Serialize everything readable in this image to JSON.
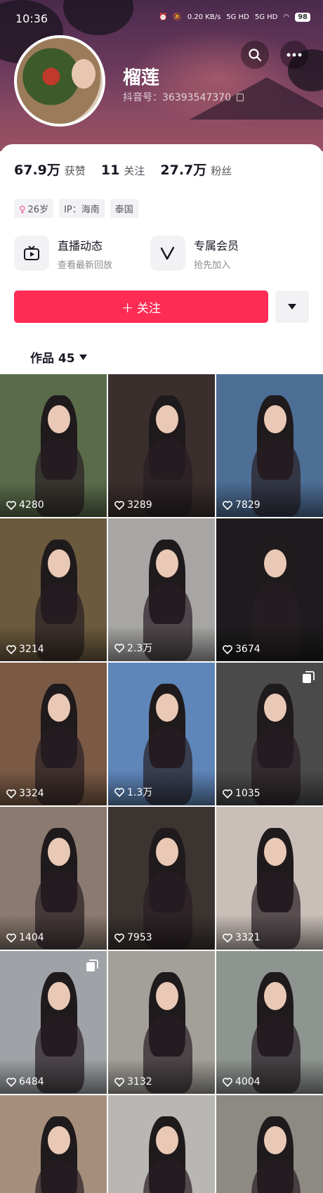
{
  "status_bar": {
    "time": "10:36",
    "net_speed": "0.20 KB/s",
    "signal_1": "5G HD",
    "signal_2": "5G HD",
    "battery": "98"
  },
  "profile": {
    "username": "榴莲",
    "douyin_id": "抖音号：36393547370",
    "stats": [
      {
        "num": "67.9万",
        "label": "获赞"
      },
      {
        "num": "11",
        "label": "关注"
      },
      {
        "num": "27.7万",
        "label": "粉丝"
      }
    ],
    "tags": {
      "gender_symbol": "♀",
      "age": "26岁",
      "ip": "IP：海南",
      "location": "泰国"
    },
    "features": [
      {
        "title": "直播动态",
        "subtitle": "查看最新回放",
        "icon": "tv-icon"
      },
      {
        "title": "专属会员",
        "subtitle": "抢先加入",
        "icon": "v-icon"
      }
    ],
    "follow_label": "＋ 关注",
    "works_label": "作品 45"
  },
  "colors": {
    "accent": "#fe2c55",
    "banner_top": "#4a2a4e",
    "banner_bottom": "#9a5262"
  },
  "grid": {
    "tiles": [
      {
        "likes": "4280",
        "bg": "#5a6b4a",
        "multi": false
      },
      {
        "likes": "3289",
        "bg": "#3a2f2d",
        "multi": false
      },
      {
        "likes": "7829",
        "bg": "#4d6e95",
        "multi": false
      },
      {
        "likes": "3214",
        "bg": "#6b5a3e",
        "multi": false
      },
      {
        "likes": "2.3万",
        "bg": "#a7a6a4",
        "multi": false
      },
      {
        "likes": "3674",
        "bg": "#1d1b1d",
        "multi": false
      },
      {
        "likes": "3324",
        "bg": "#7a5a45",
        "multi": false
      },
      {
        "likes": "1.3万",
        "bg": "#5f86b9",
        "multi": false
      },
      {
        "likes": "1035",
        "bg": "#4b4a4a",
        "multi": true
      },
      {
        "likes": "1404",
        "bg": "#8b7a6f",
        "multi": false
      },
      {
        "likes": "7953",
        "bg": "#3c3431",
        "multi": false
      },
      {
        "likes": "3321",
        "bg": "#c9beb8",
        "multi": false
      },
      {
        "likes": "6484",
        "bg": "#9fa2a6",
        "multi": true
      },
      {
        "likes": "3132",
        "bg": "#a3a099",
        "multi": false
      },
      {
        "likes": "4004",
        "bg": "#8e9490",
        "multi": false
      },
      {
        "likes": "",
        "bg": "#a58f7c",
        "multi": false
      },
      {
        "likes": "",
        "bg": "#b9b7b3",
        "multi": false
      },
      {
        "likes": "",
        "bg": "#8d8a83",
        "multi": false
      }
    ]
  }
}
